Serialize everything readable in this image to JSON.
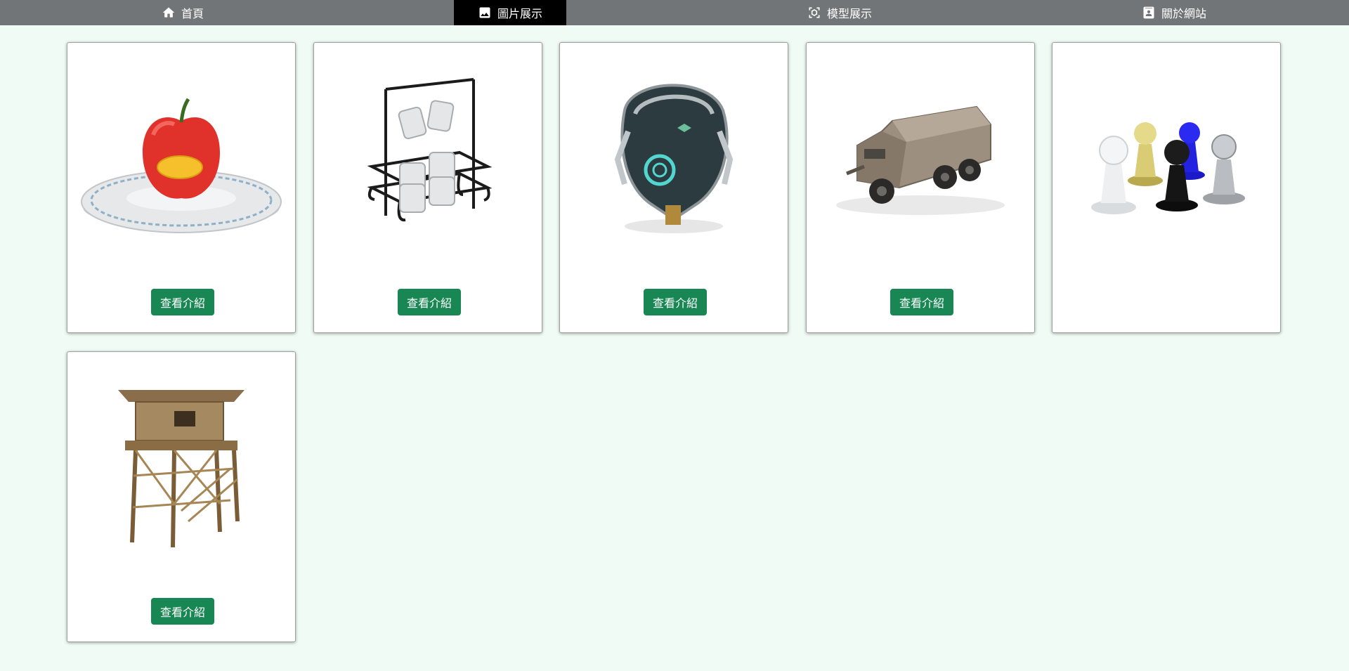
{
  "nav": {
    "items": [
      {
        "label": "首頁",
        "icon": "home-icon",
        "active": false
      },
      {
        "label": "圖片展示",
        "icon": "image-icon",
        "active": true
      },
      {
        "label": "模型展示",
        "icon": "model-3d-icon",
        "active": false
      },
      {
        "label": "關於網站",
        "icon": "contact-card-icon",
        "active": false
      }
    ],
    "bar_color": "#717577",
    "active_color": "#000000"
  },
  "gallery": {
    "button_color": "#198754",
    "cards": [
      {
        "image": "apple-on-plate",
        "button_label": "查看介紹",
        "has_button": true
      },
      {
        "image": "mug-rack",
        "button_label": "查看介紹",
        "has_button": true
      },
      {
        "image": "sci-fi-helmet",
        "button_label": "查看介紹",
        "has_button": true
      },
      {
        "image": "armored-truck",
        "button_label": "查看介紹",
        "has_button": true
      },
      {
        "image": "chess-pawns",
        "has_button": false
      },
      {
        "image": "wooden-watchtower",
        "button_label": "查看介紹",
        "has_button": true
      }
    ]
  }
}
